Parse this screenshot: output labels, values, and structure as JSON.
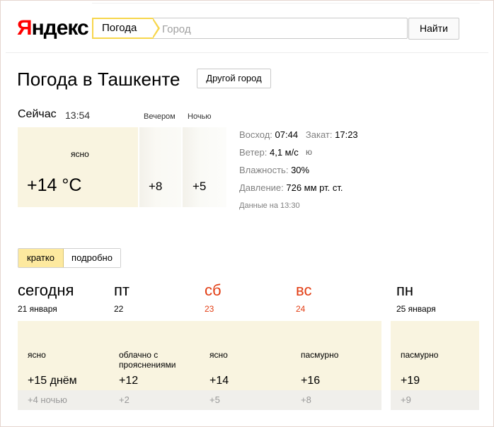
{
  "logo": {
    "part1": "Я",
    "part2": "ндекс"
  },
  "search": {
    "tag": "Погода",
    "placeholder": "Город",
    "value": "",
    "button": "Найти"
  },
  "page": {
    "title": "Погода в Ташкенте",
    "other_city_button": "Другой город"
  },
  "now": {
    "label": "Сейчас",
    "time": "13:54",
    "condition": "ясно",
    "temperature": "+14 °C",
    "evening_label": "Вечером",
    "evening_temp": "+8",
    "night_label": "Ночью",
    "night_temp": "+5"
  },
  "details": {
    "sunrise_label": "Восход:",
    "sunrise": "07:44",
    "sunset_label": "Закат:",
    "sunset": "17:23",
    "wind_label": "Ветер:",
    "wind": "4,1 м/с",
    "wind_dir": "ю",
    "humidity_label": "Влажность:",
    "humidity": "30%",
    "pressure_label": "Давление:",
    "pressure": "726 мм рт. ст.",
    "data_at": "Данные на 13:30"
  },
  "view_toggle": {
    "brief": "кратко",
    "detailed": "подробно",
    "selected": "кратко"
  },
  "forecast": [
    {
      "name": "сегодня",
      "date": "21 января",
      "condition": "ясно",
      "day_temp": "+15 днём",
      "night_temp": "+4 ночью",
      "weekend": false
    },
    {
      "name": "пт",
      "date": "22",
      "condition": "облачно с прояснениями",
      "day_temp": "+12",
      "night_temp": "+2",
      "weekend": false
    },
    {
      "name": "сб",
      "date": "23",
      "condition": "ясно",
      "day_temp": "+14",
      "night_temp": "+5",
      "weekend": true
    },
    {
      "name": "вс",
      "date": "24",
      "condition": "пасмурно",
      "day_temp": "+16",
      "night_temp": "+8",
      "weekend": true
    },
    {
      "name": "пн",
      "date": "25 января",
      "condition": "пасмурно",
      "day_temp": "+19",
      "night_temp": "+9",
      "weekend": false
    }
  ],
  "colors": {
    "weekend": "#e23d13",
    "panel": "#f9f4e0",
    "accent_yellow": "#f7d64c"
  }
}
